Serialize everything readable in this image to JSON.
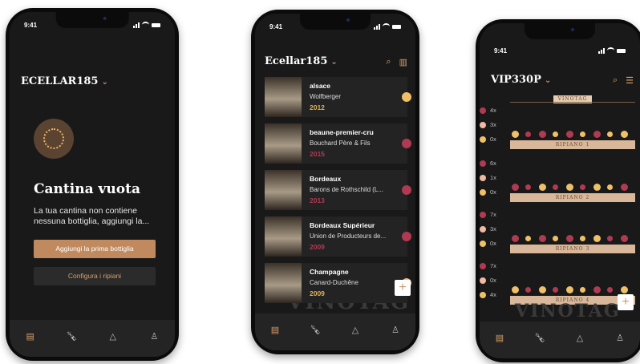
{
  "status_time": "9:41",
  "phone1": {
    "cellar_name": "ECELLAR185",
    "empty_title": "Cantina vuota",
    "empty_text": "La tua cantina non contiene nessuna bottiglia, aggiungi la...",
    "primary_button": "Aggiungi la prima bottiglia",
    "secondary_button": "Configura i ripiani"
  },
  "phone2": {
    "cellar_name": "Ecellar185",
    "wines": [
      {
        "region": "alsace",
        "producer": "Wolfberger",
        "year": "2012",
        "year_color": "#e0b25a",
        "dot_color": "#f0c068"
      },
      {
        "region": "beaune-premier-cru",
        "producer": "Bouchard Père & Fils",
        "year": "2015",
        "year_color": "#b03a52",
        "dot_color": "#b03a52"
      },
      {
        "region": "Bordeaux",
        "producer": "Barons de Rothschild (L...",
        "year": "2013",
        "year_color": "#b03a52",
        "dot_color": "#b03a52"
      },
      {
        "region": "Bordeaux Supérieur",
        "producer": "Union de Producteurs de...",
        "year": "2009",
        "year_color": "#b03a52",
        "dot_color": "#b03a52"
      },
      {
        "region": "Champagne",
        "producer": "Canard-Duchêne",
        "year": "2009",
        "year_color": "#e0b25a",
        "dot_color": "#f0c068"
      }
    ],
    "fab_label": "+",
    "watermark": "VINOTAG"
  },
  "phone3": {
    "cellar_name": "VIP330P",
    "brand_tag": "VINOTAG",
    "shelves": [
      {
        "label": "RIPIANO 1",
        "counts": [
          "4x",
          "3x",
          "0x"
        ]
      },
      {
        "label": "RIPIANO 2",
        "counts": [
          "6x",
          "1x",
          "0x"
        ]
      },
      {
        "label": "RIPIANO 3",
        "counts": [
          "7x",
          "3x",
          "0x"
        ]
      },
      {
        "label": "RIPIANO 4",
        "counts": [
          "7x",
          "0x",
          "4x"
        ]
      }
    ],
    "extra_count": "1x",
    "fab_label": "+",
    "watermark": "VINOTAG"
  },
  "colors": {
    "red_wine": "#b03a52",
    "white_wine": "#f0c068",
    "rose_wine": "#f2b9a2",
    "accent": "#c99a6e"
  },
  "icons": {
    "chevron": "chevron-down-icon",
    "search": "search-icon",
    "bottle": "bottle-icon",
    "bell": "bell-icon",
    "user": "user-icon",
    "cellar": "cellar-icon",
    "list": "list-icon",
    "add": "plus-icon"
  }
}
